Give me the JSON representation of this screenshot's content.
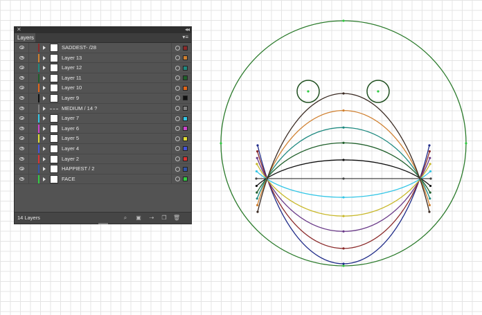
{
  "panel": {
    "tab_label": "Layers",
    "menu_icon": "panel-menu-icon",
    "close_icon": "close-icon",
    "collapse_icon": "collapse-icon"
  },
  "layers": [
    {
      "name": "SADDEST- /28",
      "color": "#8b2a2a",
      "thumb": "solid"
    },
    {
      "name": "Layer 13",
      "color": "#d08030",
      "thumb": "solid"
    },
    {
      "name": "Layer 12",
      "color": "#1f8a80",
      "thumb": "solid"
    },
    {
      "name": "Layer 11",
      "color": "#1f5f2a",
      "thumb": "solid"
    },
    {
      "name": "Layer 10",
      "color": "#e0661a",
      "thumb": "solid"
    },
    {
      "name": "Layer 9",
      "color": "#111111",
      "thumb": "solid"
    },
    {
      "name": "MEDIUM / 14 ?",
      "color": "#808080",
      "thumb": "dashed"
    },
    {
      "name": "Layer 7",
      "color": "#33c6e6",
      "thumb": "solid"
    },
    {
      "name": "Layer 6",
      "color": "#cc44cc",
      "thumb": "solid"
    },
    {
      "name": "Layer 5",
      "color": "#e0dc33",
      "thumb": "solid"
    },
    {
      "name": "Layer 4",
      "color": "#4455dd",
      "thumb": "solid"
    },
    {
      "name": "Layer 2",
      "color": "#dd3333",
      "thumb": "solid"
    },
    {
      "name": "HAPPIEST  / 2",
      "color": "#3355aa",
      "thumb": "solid"
    },
    {
      "name": "FACE",
      "color": "#33cc44",
      "thumb": "solid"
    }
  ],
  "footer": {
    "count_label": "14 Layers",
    "icons": [
      "search-icon",
      "make-clip-mask-icon",
      "new-sublayer-icon",
      "new-layer-icon",
      "delete-icon"
    ]
  },
  "artwork": {
    "face_color": "#2a7a2a",
    "eye_color": "#1f4f1f",
    "anchor_color": "#2ecc40",
    "mouth_curves": [
      {
        "color": "#1e2a88",
        "depth": 1.0
      },
      {
        "color": "#8b2a2a",
        "depth": 0.82
      },
      {
        "color": "#6a3a88",
        "depth": 0.62
      },
      {
        "color": "#c8b82a",
        "depth": 0.44
      },
      {
        "color": "#33c6e6",
        "depth": 0.22
      },
      {
        "color": "#444444",
        "depth": 0.0
      },
      {
        "color": "#111111",
        "depth": -0.22
      },
      {
        "color": "#1f5f2a",
        "depth": -0.42
      },
      {
        "color": "#1f8a80",
        "depth": -0.6
      },
      {
        "color": "#d08030",
        "depth": -0.8
      },
      {
        "color": "#3a2a22",
        "depth": -1.0
      }
    ]
  }
}
